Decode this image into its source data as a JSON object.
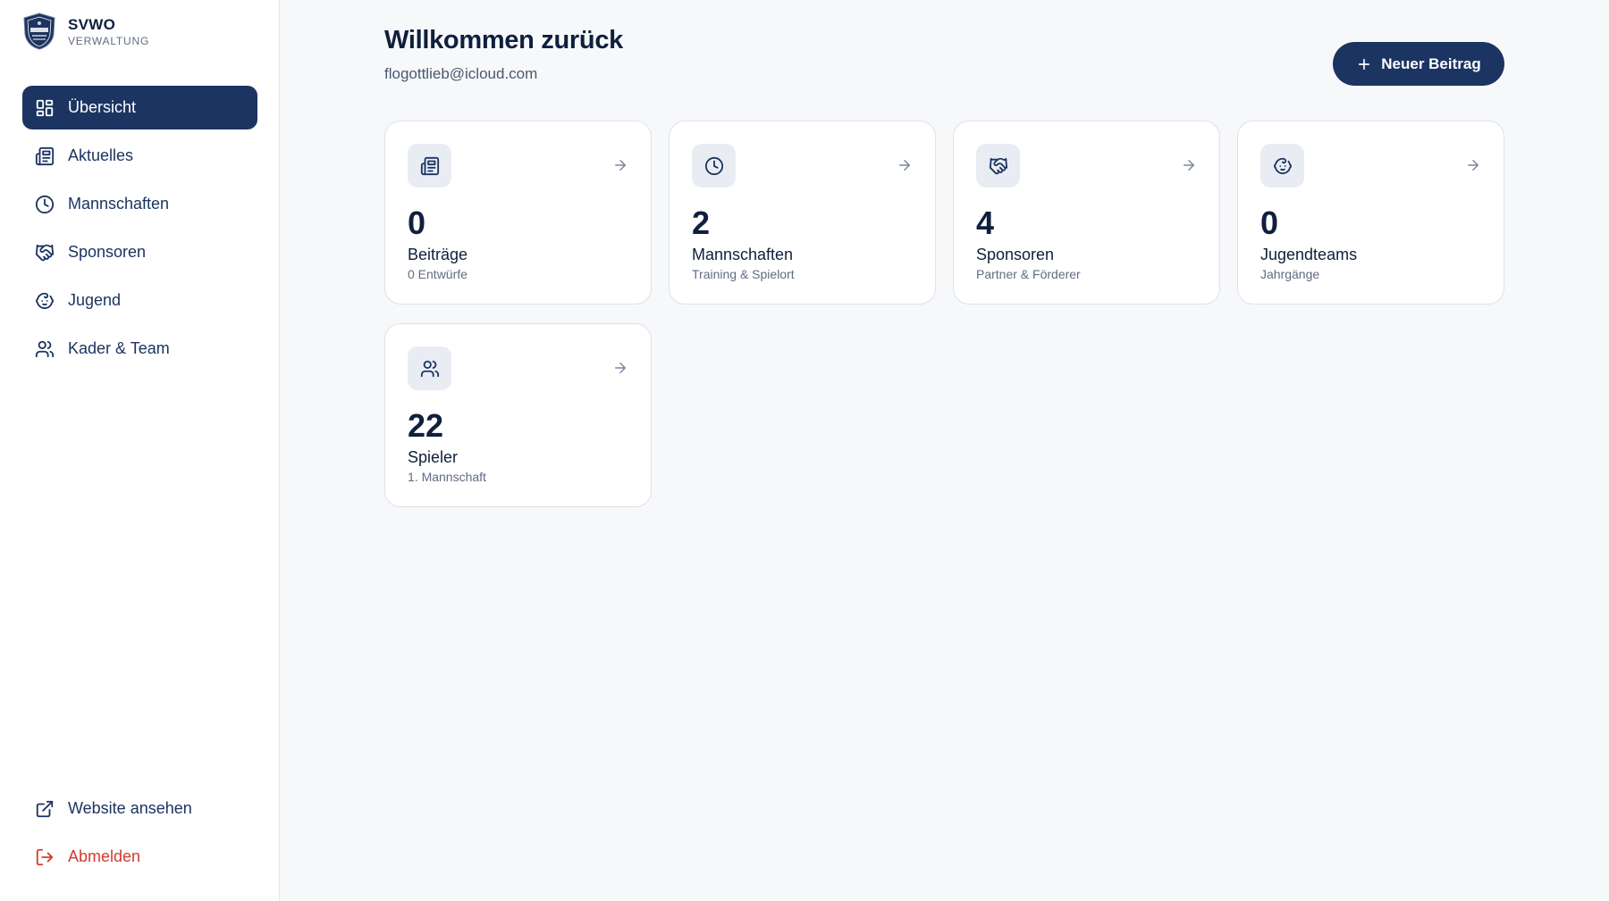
{
  "brand": {
    "name": "SVWO",
    "subtitle": "VERWALTUNG",
    "logo_icon": "club-shield-icon"
  },
  "sidebar": {
    "items": [
      {
        "label": "Übersicht",
        "icon": "dashboard-grid-icon",
        "active": true
      },
      {
        "label": "Aktuelles",
        "icon": "newspaper-icon",
        "active": false
      },
      {
        "label": "Mannschaften",
        "icon": "clock-icon",
        "active": false
      },
      {
        "label": "Sponsoren",
        "icon": "handshake-icon",
        "active": false
      },
      {
        "label": "Jugend",
        "icon": "baby-face-icon",
        "active": false
      },
      {
        "label": "Kader & Team",
        "icon": "users-icon",
        "active": false
      }
    ],
    "bottom": [
      {
        "label": "Website ansehen",
        "icon": "external-link-icon"
      },
      {
        "label": "Abmelden",
        "icon": "logout-icon"
      }
    ]
  },
  "header": {
    "title": "Willkommen zurück",
    "email": "flogottlieb@icloud.com",
    "new_post_label": "Neuer Beitrag"
  },
  "cards": [
    {
      "value": "0",
      "title": "Beiträge",
      "subtitle": "0 Entwürfe",
      "icon": "newspaper-icon"
    },
    {
      "value": "2",
      "title": "Mannschaften",
      "subtitle": "Training & Spielort",
      "icon": "clock-icon"
    },
    {
      "value": "4",
      "title": "Sponsoren",
      "subtitle": "Partner & Förderer",
      "icon": "handshake-icon"
    },
    {
      "value": "0",
      "title": "Jugendteams",
      "subtitle": "Jahrgänge",
      "icon": "baby-face-icon"
    },
    {
      "value": "22",
      "title": "Spieler",
      "subtitle": "1. Mannschaft",
      "icon": "users-icon"
    }
  ],
  "colors": {
    "primary": "#1c3461",
    "danger": "#d43b2c",
    "background": "#f7f8fa",
    "card_border": "#dde2ea",
    "icon_tile": "#e9edf3"
  }
}
